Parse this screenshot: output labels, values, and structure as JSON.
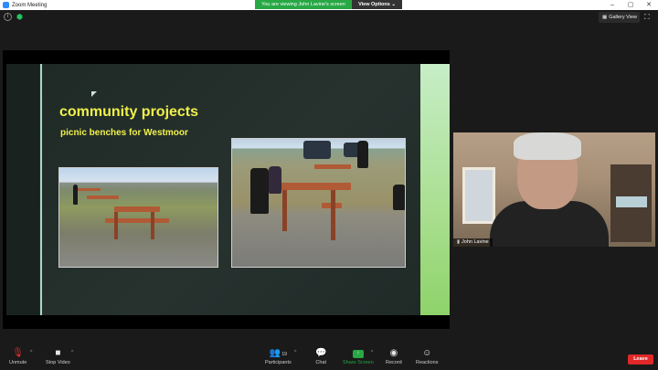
{
  "window": {
    "title": "Zoom Meeting",
    "controls": [
      "–",
      "▢",
      "✕"
    ]
  },
  "share_banner": {
    "text": "You are viewing John Lavine's screen",
    "view_options": "View Options ⌄"
  },
  "top_right": {
    "gallery_view": "Gallery View"
  },
  "slide": {
    "title": "community projects",
    "subtitle": "picnic benches for Westmoor"
  },
  "participant": {
    "name": "John Lavine"
  },
  "toolbar": {
    "unmute": "Unmute",
    "stop_video": "Stop Video",
    "participants": "Participants",
    "participants_count": "19",
    "chat": "Chat",
    "share_screen": "Share Screen",
    "record": "Record",
    "reactions": "Reactions",
    "leave": "Leave"
  },
  "colors": {
    "accent_green": "#27a844",
    "leave_red": "#e02828",
    "slide_text": "#f1f14b"
  }
}
